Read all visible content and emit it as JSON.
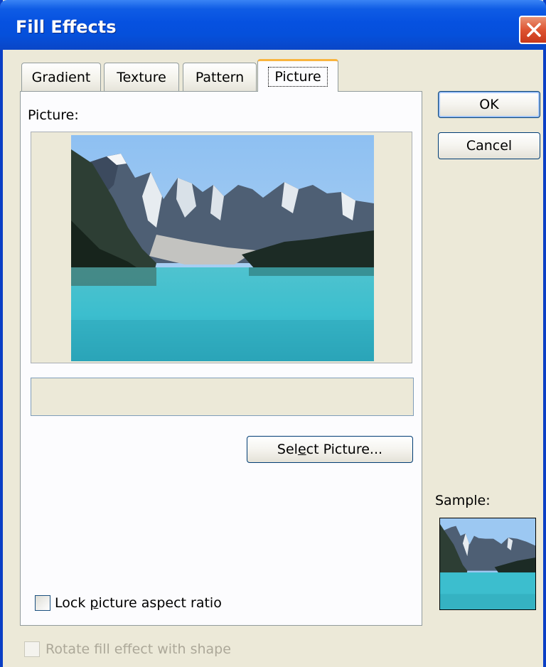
{
  "window": {
    "title": "Fill Effects"
  },
  "tabs": [
    {
      "label": "Gradient"
    },
    {
      "label": "Texture"
    },
    {
      "label": "Pattern"
    },
    {
      "label": "Picture"
    }
  ],
  "picture_tab": {
    "picture_label": "Picture:",
    "picture_name": "",
    "select_button": {
      "pre": "Sel",
      "accel": "e",
      "post": "ct Picture..."
    },
    "lock_aspect": {
      "pre": "Lock ",
      "accel": "p",
      "post": "icture aspect ratio",
      "checked": false
    }
  },
  "buttons": {
    "ok": "OK",
    "cancel": "Cancel"
  },
  "sample_label": "Sample:",
  "rotate_fill": {
    "label": "Rotate fill effect with shape",
    "checked": false,
    "enabled": false
  },
  "colors": {
    "titlebar": "#0651E0",
    "dialog_bg": "#ECE9D8",
    "active_tab_accent": "#F9B43E",
    "close_button": "#DE5432"
  }
}
